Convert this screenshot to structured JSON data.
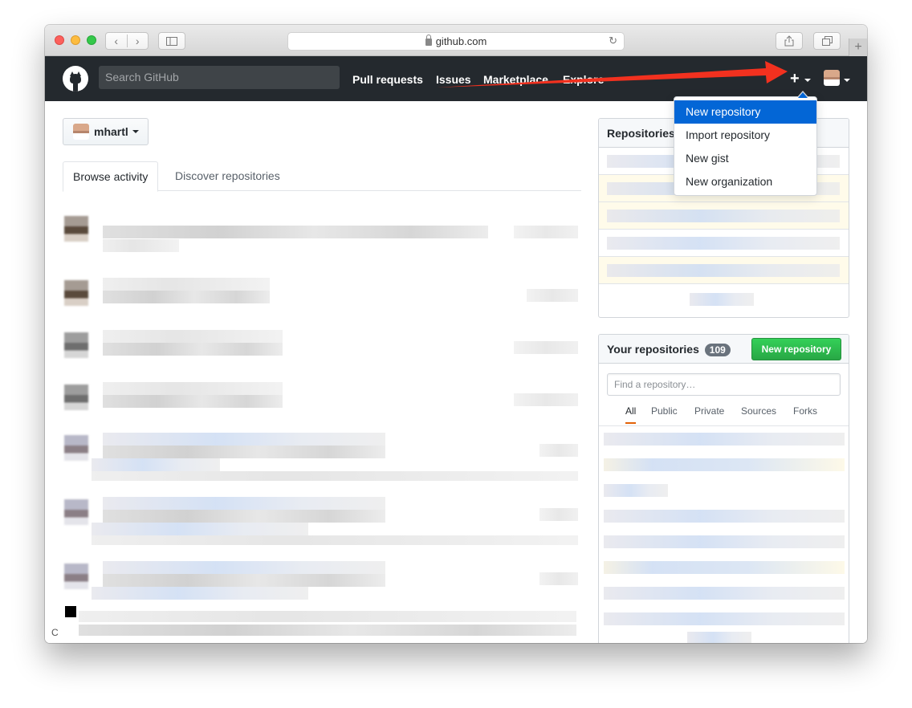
{
  "browser": {
    "url": "github.com",
    "new_tab_label": "+"
  },
  "header": {
    "search_placeholder": "Search GitHub",
    "nav": [
      "Pull requests",
      "Issues",
      "Marketplace",
      "Explore"
    ]
  },
  "create_menu": {
    "items": [
      "New repository",
      "Import repository",
      "New gist",
      "New organization"
    ]
  },
  "user_switcher": {
    "username": "mhartl"
  },
  "activity_tabs": [
    "Browse activity",
    "Discover repositories"
  ],
  "repositories_panel": {
    "title": "Repositories"
  },
  "your_repositories": {
    "title": "Your repositories",
    "count": "109",
    "new_button": "New repository",
    "filter_placeholder": "Find a repository…",
    "filters": [
      "All",
      "Public",
      "Private",
      "Sources",
      "Forks"
    ]
  },
  "status_bar": {
    "text": "C"
  },
  "colors": {
    "header_bg": "#24292e",
    "link_blue": "#0366d6",
    "green_button": "#28a745",
    "annotation_red": "#f2311f"
  }
}
